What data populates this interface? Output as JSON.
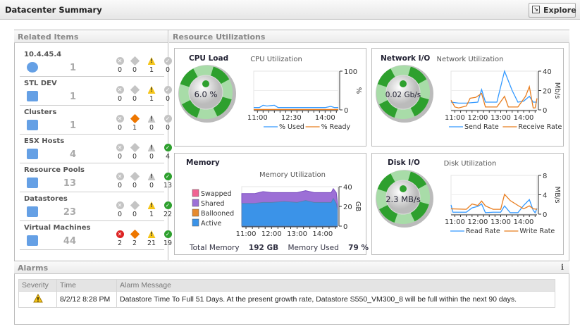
{
  "header": {
    "title": "Datacenter Summary",
    "explore_label": "Explore"
  },
  "related": {
    "title": "Related Items",
    "status_icons": [
      "critical-icon",
      "major-icon",
      "warning-icon",
      "normal-icon"
    ],
    "items": [
      {
        "name": "10.4.45.4",
        "icon": "vcenter-icon",
        "count": "1",
        "status": [
          "0",
          "0",
          "1",
          "0"
        ],
        "active": [
          false,
          false,
          true,
          false
        ]
      },
      {
        "name": "STL DEV",
        "icon": "datacenter-building-icon",
        "count": "1",
        "status": [
          "0",
          "0",
          "1",
          "0"
        ],
        "active": [
          false,
          false,
          true,
          false
        ]
      },
      {
        "name": "Clusters",
        "icon": "cluster-icon",
        "count": "1",
        "status": [
          "0",
          "1",
          "0",
          "0"
        ],
        "active": [
          false,
          true,
          false,
          false
        ]
      },
      {
        "name": "ESX Hosts",
        "icon": "esx-host-icon",
        "count": "4",
        "status": [
          "0",
          "0",
          "0",
          "4"
        ],
        "active": [
          false,
          false,
          false,
          true
        ]
      },
      {
        "name": "Resource Pools",
        "icon": "resource-pool-icon",
        "count": "13",
        "status": [
          "0",
          "0",
          "0",
          "13"
        ],
        "active": [
          false,
          false,
          false,
          true
        ]
      },
      {
        "name": "Datastores",
        "icon": "datastore-icon",
        "count": "23",
        "status": [
          "0",
          "0",
          "1",
          "22"
        ],
        "active": [
          false,
          false,
          true,
          true
        ]
      },
      {
        "name": "Virtual Machines",
        "icon": "virtual-machine-icon",
        "count": "44",
        "status": [
          "2",
          "2",
          "21",
          "19"
        ],
        "active": [
          true,
          true,
          true,
          true
        ]
      }
    ]
  },
  "resources": {
    "title": "Resource Utilizations",
    "cpu": {
      "title": "CPU Load",
      "gauge_value": "6.0 %",
      "gauge_status": "normal"
    },
    "network": {
      "title": "Network I/O",
      "gauge_value": "0.02 Gb/s",
      "gauge_status": "normal"
    },
    "memory": {
      "title": "Memory",
      "total_label": "Total Memory",
      "total_value": "192 GB",
      "used_label": "Memory Used",
      "used_value": "79 %"
    },
    "disk": {
      "title": "Disk I/O",
      "gauge_value": "2.3 MB/s",
      "gauge_status": "normal"
    }
  },
  "colors": {
    "blue": "#3399ff",
    "orange": "#e87d1e",
    "purple": "#9c6fd6",
    "active": "#3b93e8",
    "swapped": "#f06292",
    "ballooned": "#e68a2e",
    "green": "#2ea02e"
  },
  "chart_data": [
    {
      "id": "cpu",
      "type": "line",
      "title": "CPU Utilization",
      "ylabel": "%",
      "ylim": [
        0,
        100
      ],
      "yticks": [
        "0",
        "100"
      ],
      "xlim": [
        "10:50",
        "14:35"
      ],
      "xticks": [
        "11:00",
        "12:30",
        "14:00"
      ],
      "series": [
        {
          "name": "% Used",
          "color": "#3399ff",
          "x": [
            "10:50",
            "11:05",
            "11:15",
            "11:25",
            "11:35",
            "11:45",
            "11:55",
            "13:00",
            "14:00",
            "14:15",
            "14:25",
            "14:35"
          ],
          "y": [
            6,
            6,
            12,
            10,
            11,
            12,
            6,
            6,
            6,
            9,
            6,
            6
          ]
        },
        {
          "name": "% Ready",
          "color": "#e87d1e",
          "x": [
            "10:50",
            "14:35"
          ],
          "y": [
            1,
            1
          ]
        }
      ]
    },
    {
      "id": "net",
      "type": "line",
      "title": "Network Utilization",
      "ylabel": "Mb/s",
      "ylim": [
        0,
        40
      ],
      "yticks": [
        "0",
        "20",
        "40"
      ],
      "xlim": [
        "10:50",
        "14:35"
      ],
      "xticks": [
        "11:00",
        "12:00",
        "13:00",
        "14:00"
      ],
      "series": [
        {
          "name": "Send Rate",
          "color": "#3399ff",
          "x": [
            "10:50",
            "11:10",
            "11:30",
            "12:00",
            "12:10",
            "12:20",
            "12:50",
            "13:10",
            "13:30",
            "13:45",
            "14:00",
            "14:15",
            "14:25",
            "14:35"
          ],
          "y": [
            8,
            7,
            7,
            8,
            21,
            8,
            8,
            40,
            20,
            8,
            9,
            14,
            8,
            8
          ]
        },
        {
          "name": "Receive Rate",
          "color": "#e87d1e",
          "x": [
            "10:50",
            "11:00",
            "11:10",
            "11:30",
            "11:40",
            "11:55",
            "12:10",
            "12:20",
            "12:50",
            "13:10",
            "13:20",
            "13:45",
            "14:05",
            "14:15",
            "14:25",
            "14:30",
            "14:35"
          ],
          "y": [
            10,
            3,
            2,
            4,
            12,
            13,
            17,
            3,
            3,
            14,
            3,
            3,
            14,
            24,
            2,
            2,
            12
          ]
        }
      ]
    },
    {
      "id": "mem",
      "type": "area",
      "title": "Memory Utilization",
      "ylabel": "GB",
      "ylim": [
        0,
        40
      ],
      "yticks": [
        "0",
        "20",
        "40"
      ],
      "xlim": [
        "10:50",
        "14:35"
      ],
      "xticks": [
        "11:00",
        "12:00",
        "13:00",
        "14:00"
      ],
      "series": [
        {
          "name": "Swapped",
          "color": "#f06292",
          "x": [],
          "y": []
        },
        {
          "name": "Shared",
          "color": "#9c6fd6",
          "x": [
            "10:50",
            "11:20",
            "11:40",
            "12:00",
            "12:30",
            "13:00",
            "13:20",
            "13:40",
            "14:00",
            "14:20",
            "14:25",
            "14:32",
            "14:35"
          ],
          "y": [
            33,
            33,
            35,
            34,
            34,
            34,
            36,
            34,
            34,
            34,
            38,
            34,
            22
          ]
        },
        {
          "name": "Ballooned",
          "color": "#e68a2e",
          "x": [],
          "y": []
        },
        {
          "name": "Active",
          "color": "#3b93e8",
          "x": [
            "10:50",
            "11:20",
            "11:40",
            "12:00",
            "12:30",
            "13:00",
            "13:20",
            "13:40",
            "14:00",
            "14:20",
            "14:25",
            "14:32",
            "14:35"
          ],
          "y": [
            23,
            23,
            24,
            24,
            25,
            24,
            26,
            24,
            24,
            24,
            28,
            23,
            16
          ]
        }
      ]
    },
    {
      "id": "disk",
      "type": "line",
      "title": "Disk Utilization",
      "ylabel": "MB/s",
      "ylim": [
        0,
        8
      ],
      "yticks": [
        "0",
        "4",
        "8"
      ],
      "xlim": [
        "10:50",
        "14:35"
      ],
      "xticks": [
        "11:00",
        "12:00",
        "13:00",
        "14:00"
      ],
      "series": [
        {
          "name": "Read Rate",
          "color": "#3399ff",
          "x": [
            "10:50",
            "10:55",
            "11:30",
            "11:45",
            "12:00",
            "12:10",
            "12:20",
            "12:40",
            "13:00",
            "13:10",
            "13:25",
            "13:45",
            "14:00",
            "14:15",
            "14:25",
            "14:30",
            "14:35"
          ],
          "y": [
            1.9,
            0.4,
            0.4,
            1.3,
            1.6,
            2.1,
            0.3,
            0.4,
            0.4,
            1.7,
            0.3,
            0.3,
            1.8,
            3,
            0.8,
            0.3,
            1.2
          ]
        },
        {
          "name": "Write Rate",
          "color": "#e87d1e",
          "x": [
            "10:50",
            "11:30",
            "11:45",
            "12:00",
            "12:10",
            "12:20",
            "12:40",
            "13:00",
            "13:10",
            "13:25",
            "13:45",
            "14:00",
            "14:15",
            "14:25",
            "14:35"
          ],
          "y": [
            1.1,
            1,
            2.1,
            1.8,
            2.7,
            1.7,
            1,
            1,
            4.1,
            2.8,
            1.8,
            1.1,
            1.7,
            1.1,
            1
          ]
        }
      ]
    }
  ],
  "alarms": {
    "title": "Alarms",
    "info_label": "i",
    "columns": [
      "Severity",
      "Time",
      "Alarm Message"
    ],
    "rows": [
      {
        "severity": "warning",
        "time": "8/2/12 8:28 PM",
        "message": "Datastore Time To Full 51 Days. At the present growth rate, Datastore S550_VM300_8 will be full within the next 90 days."
      }
    ]
  }
}
